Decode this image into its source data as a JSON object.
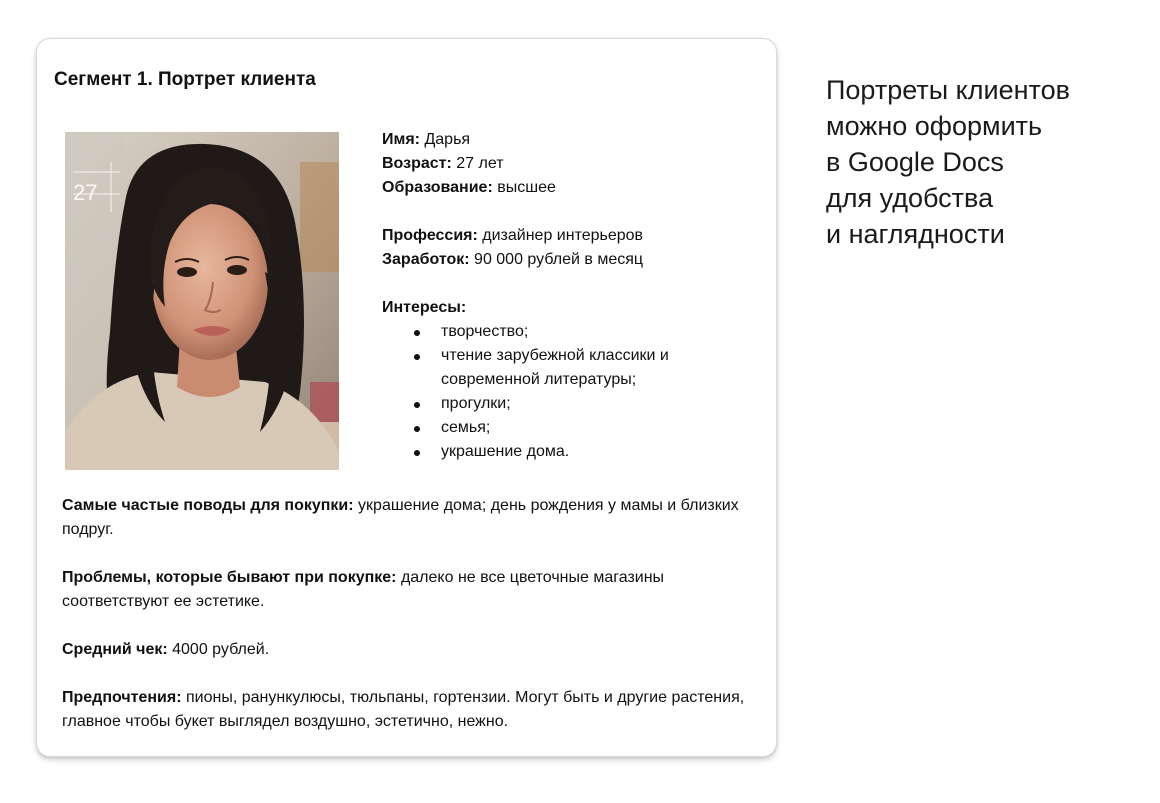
{
  "doc": {
    "title": "Сегмент 1. Портрет клиента",
    "photo_alt": "Портрет женщины с тёмными волосами",
    "photo_overlay_text": "27",
    "name_label": "Имя:",
    "name_value": " Дарья",
    "age_label": "Возраст:",
    "age_value": " 27 лет",
    "education_label": "Образование:",
    "education_value": " высшее",
    "profession_label": "Профессия:",
    "profession_value": " дизайнер интерьеров",
    "income_label": "Заработок:",
    "income_value": " 90 000 рублей в месяц",
    "interests_label": "Интересы:",
    "interests": [
      "творчество;",
      "чтение зарубежной классики и современной литературы;",
      "прогулки;",
      "семья;",
      "украшение дома."
    ],
    "occasions_label": "Самые частые поводы для покупки:",
    "occasions_value": " украшение дома; день рождения у мамы и близких подруг.",
    "problems_label": "Проблемы, которые бывают при покупке:",
    "problems_value": " далеко не все цветочные магазины соответствуют ее эстетике.",
    "check_label": "Средний чек:",
    "check_value": " 4000 рублей.",
    "prefs_label": "Предпочтения:",
    "prefs_value": " пионы, ранункулюсы, тюльпаны, гортензии. Могут быть и другие растения, главное чтобы букет выглядел воздушно, эстетично, нежно."
  },
  "side_caption": [
    "Портреты клиентов",
    "можно оформить",
    "в Google Docs",
    "для удобства",
    "и наглядности"
  ]
}
